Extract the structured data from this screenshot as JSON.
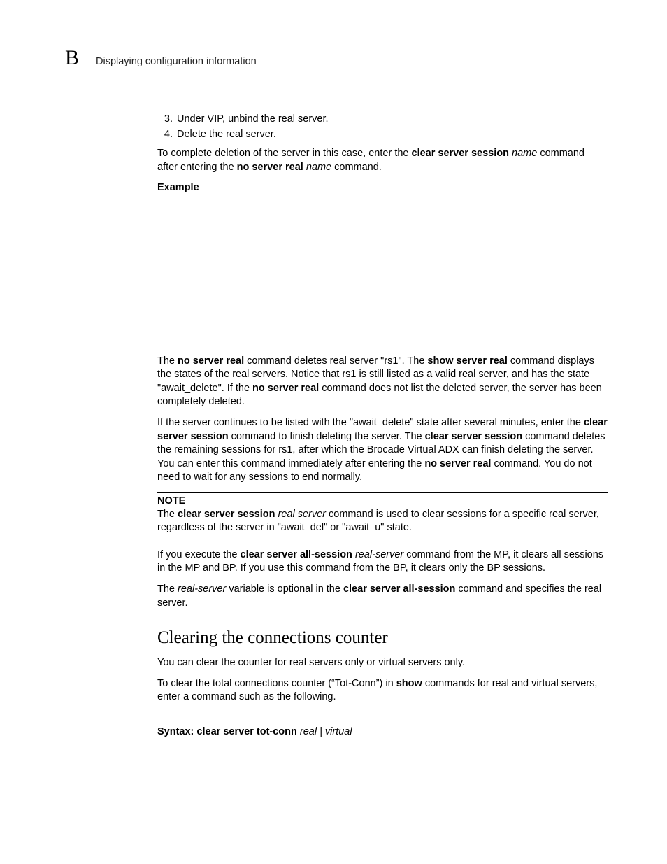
{
  "header": {
    "appendix_letter": "B",
    "title": "Displaying configuration information"
  },
  "steps": {
    "start": 3,
    "items": [
      "Under VIP, unbind the real server.",
      "Delete the real server."
    ]
  },
  "p1": {
    "t1": "To complete deletion of the server in this case, enter the ",
    "b1": "clear server session",
    "i1": " name",
    "t2": " command after entering the ",
    "b2": "no server real",
    "i2": " name",
    "t3": " command."
  },
  "example_label": "Example",
  "p2": {
    "t1": "The ",
    "b1": "no server real",
    "t2": " command deletes real server \"rs1\". The ",
    "b2": "show server real",
    "t3": " command displays the states of the real servers. Notice that rs1 is still listed as a valid real server, and has the state \"await_delete\". If the ",
    "b3": "no server real",
    "t4": " command does not list the deleted server, the server has been completely deleted."
  },
  "p3": {
    "t1": "If the server continues to be listed with the \"await_delete\" state after several minutes, enter the ",
    "b1": "clear server session",
    "t2": " command to finish deleting the server. The ",
    "b2": "clear server session",
    "t3": " command deletes the remaining sessions for rs1, after which the Brocade Virtual ADX can finish deleting the server. You can enter this command immediately after entering the ",
    "b3": "no server real",
    "t4": " command. You do not need to wait for any sessions to end normally."
  },
  "note": {
    "heading": "NOTE",
    "t1": "The ",
    "b1": "clear server session",
    "i1": " real server",
    "t2": " command is used to clear sessions for a specific real server, regardless of the server in \"await_del\" or \"await_u\" state."
  },
  "p4": {
    "t1": "If you execute the ",
    "b1": "clear server all-session",
    "i1": " real-server",
    "t2": " command from the MP, it clears all sessions in the MP and BP. If you use this command from the BP, it clears only the BP sessions."
  },
  "p5": {
    "t1": "The ",
    "i1": "real-server",
    "t2": " variable is optional in the ",
    "b1": "clear server all-session",
    "t3": " command and specifies the real server."
  },
  "section_heading": "Clearing the connections counter",
  "p6": "You can clear the counter for real servers only or virtual servers only.",
  "p7": {
    "t1": "To clear the total connections counter (“Tot-Conn”) in ",
    "b1": "show",
    "t2": " commands for real and virtual servers, enter a command such as the following."
  },
  "syntax": {
    "label": "Syntax:   ",
    "cmd": "clear server tot-conn",
    "args": " real | virtual"
  }
}
